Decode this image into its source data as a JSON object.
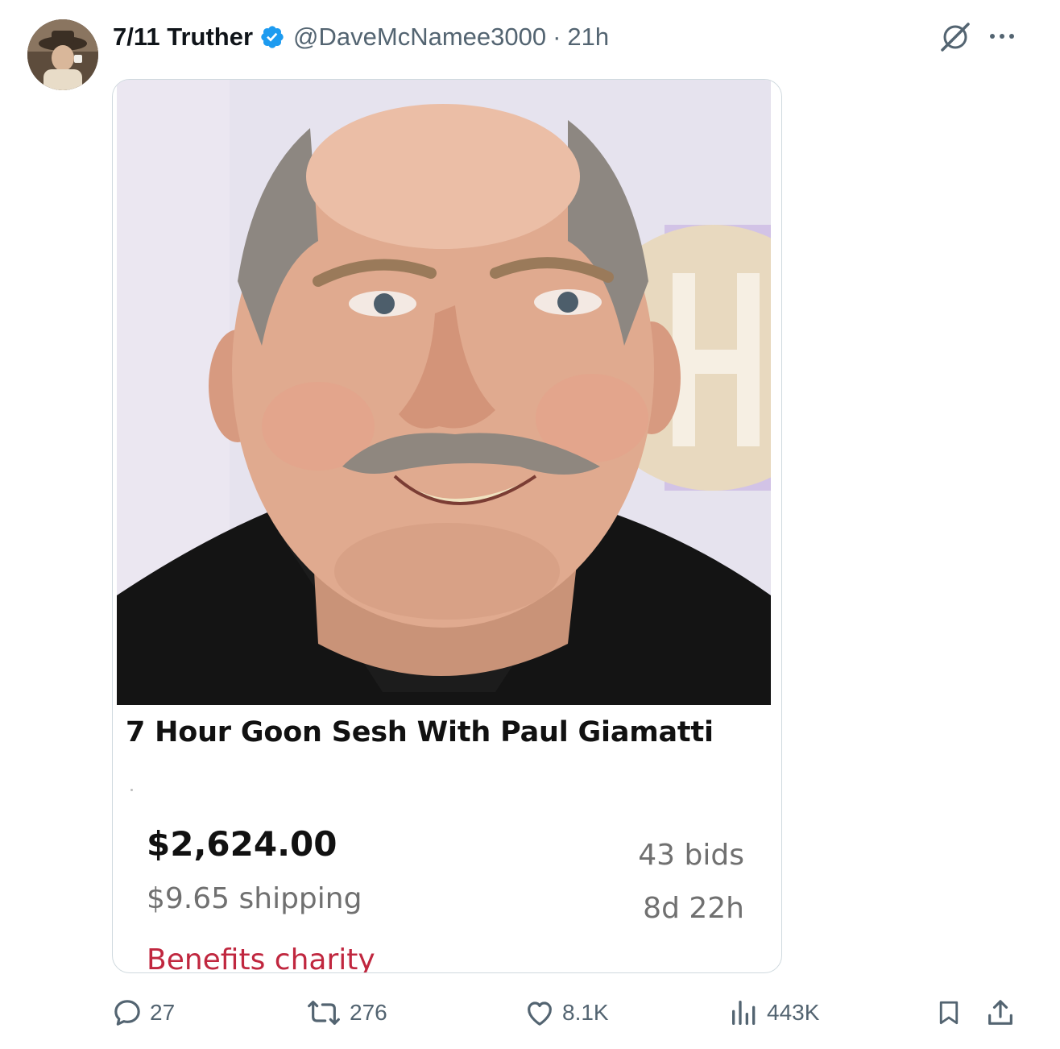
{
  "post": {
    "display_name": "7/11 Truther",
    "handle": "@DaveMcNamee3000",
    "separator": "·",
    "timestamp": "21h"
  },
  "icons": {
    "verified": "verified-badge-icon",
    "grok": "grok-icon",
    "more": "more-options-icon",
    "reply": "reply-icon",
    "repost": "repost-icon",
    "like": "like-icon",
    "views": "views-icon",
    "bookmark": "bookmark-icon",
    "share": "share-icon"
  },
  "listing": {
    "title": "7 Hour Goon Sesh With Paul Giamatti",
    "price": "$2,624.00",
    "shipping": "$9.65 shipping",
    "charity": "Benefits charity",
    "bids": "43 bids",
    "time_left": "8d 22h"
  },
  "actions": {
    "replies": "27",
    "reposts": "276",
    "likes": "8.1K",
    "views": "443K"
  },
  "colors": {
    "verified_blue": "#1d9bf0",
    "secondary_text": "#536471",
    "charity_red": "#c0273f",
    "card_border": "#cfd9de"
  }
}
